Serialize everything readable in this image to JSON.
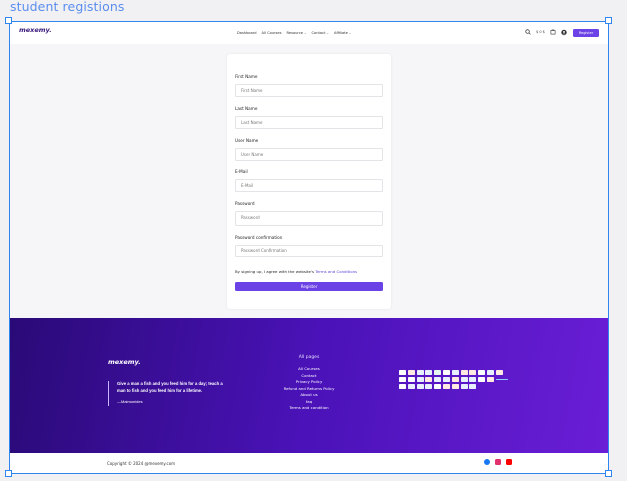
{
  "canvas_title": "student registions",
  "header": {
    "logo": "mexemy.",
    "nav": [
      {
        "label": "Dashboard",
        "dropdown": false
      },
      {
        "label": "All Courses",
        "dropdown": false
      },
      {
        "label": "Resource",
        "dropdown": true
      },
      {
        "label": "Contact",
        "dropdown": true
      },
      {
        "label": "Affiliate",
        "dropdown": true
      }
    ],
    "currency": "$ 0 $",
    "register_label": "Register"
  },
  "form": {
    "fields": [
      {
        "label": "First Name",
        "placeholder": "First Name"
      },
      {
        "label": "Last Name",
        "placeholder": "Last Name"
      },
      {
        "label": "User Name",
        "placeholder": "User Name"
      },
      {
        "label": "E-Mail",
        "placeholder": "E-Mail"
      },
      {
        "label": "Password",
        "placeholder": "Password"
      },
      {
        "label": "Password confirmation",
        "placeholder": "Password Confirmation"
      }
    ],
    "terms_prefix": "By signing up, I agree with the website's",
    "terms_link": "Terms and Conditions",
    "submit_label": "Register"
  },
  "footer": {
    "logo": "mexemy.",
    "quote": "Give a man a fish and you feed him for a day; teach a man to fish and you feed him for a lifetime.",
    "quote_author": "—Maimonides",
    "links_heading": "All pages",
    "links": [
      "All Courses",
      "Contact",
      "Privacy Policy",
      "Refund and Returns Policy",
      "About us",
      "faq",
      "Terms and condition"
    ],
    "copyright": "Copyright © 2024 @mexemy.com"
  },
  "colors": {
    "accent": "#6a42e6",
    "footer_start": "#2a0a77",
    "footer_end": "#6a1ed6",
    "selection": "#2f86f0"
  },
  "icons": [
    "search-icon",
    "cart-icon",
    "user-icon",
    "facebook-icon",
    "instagram-icon",
    "youtube-icon"
  ]
}
